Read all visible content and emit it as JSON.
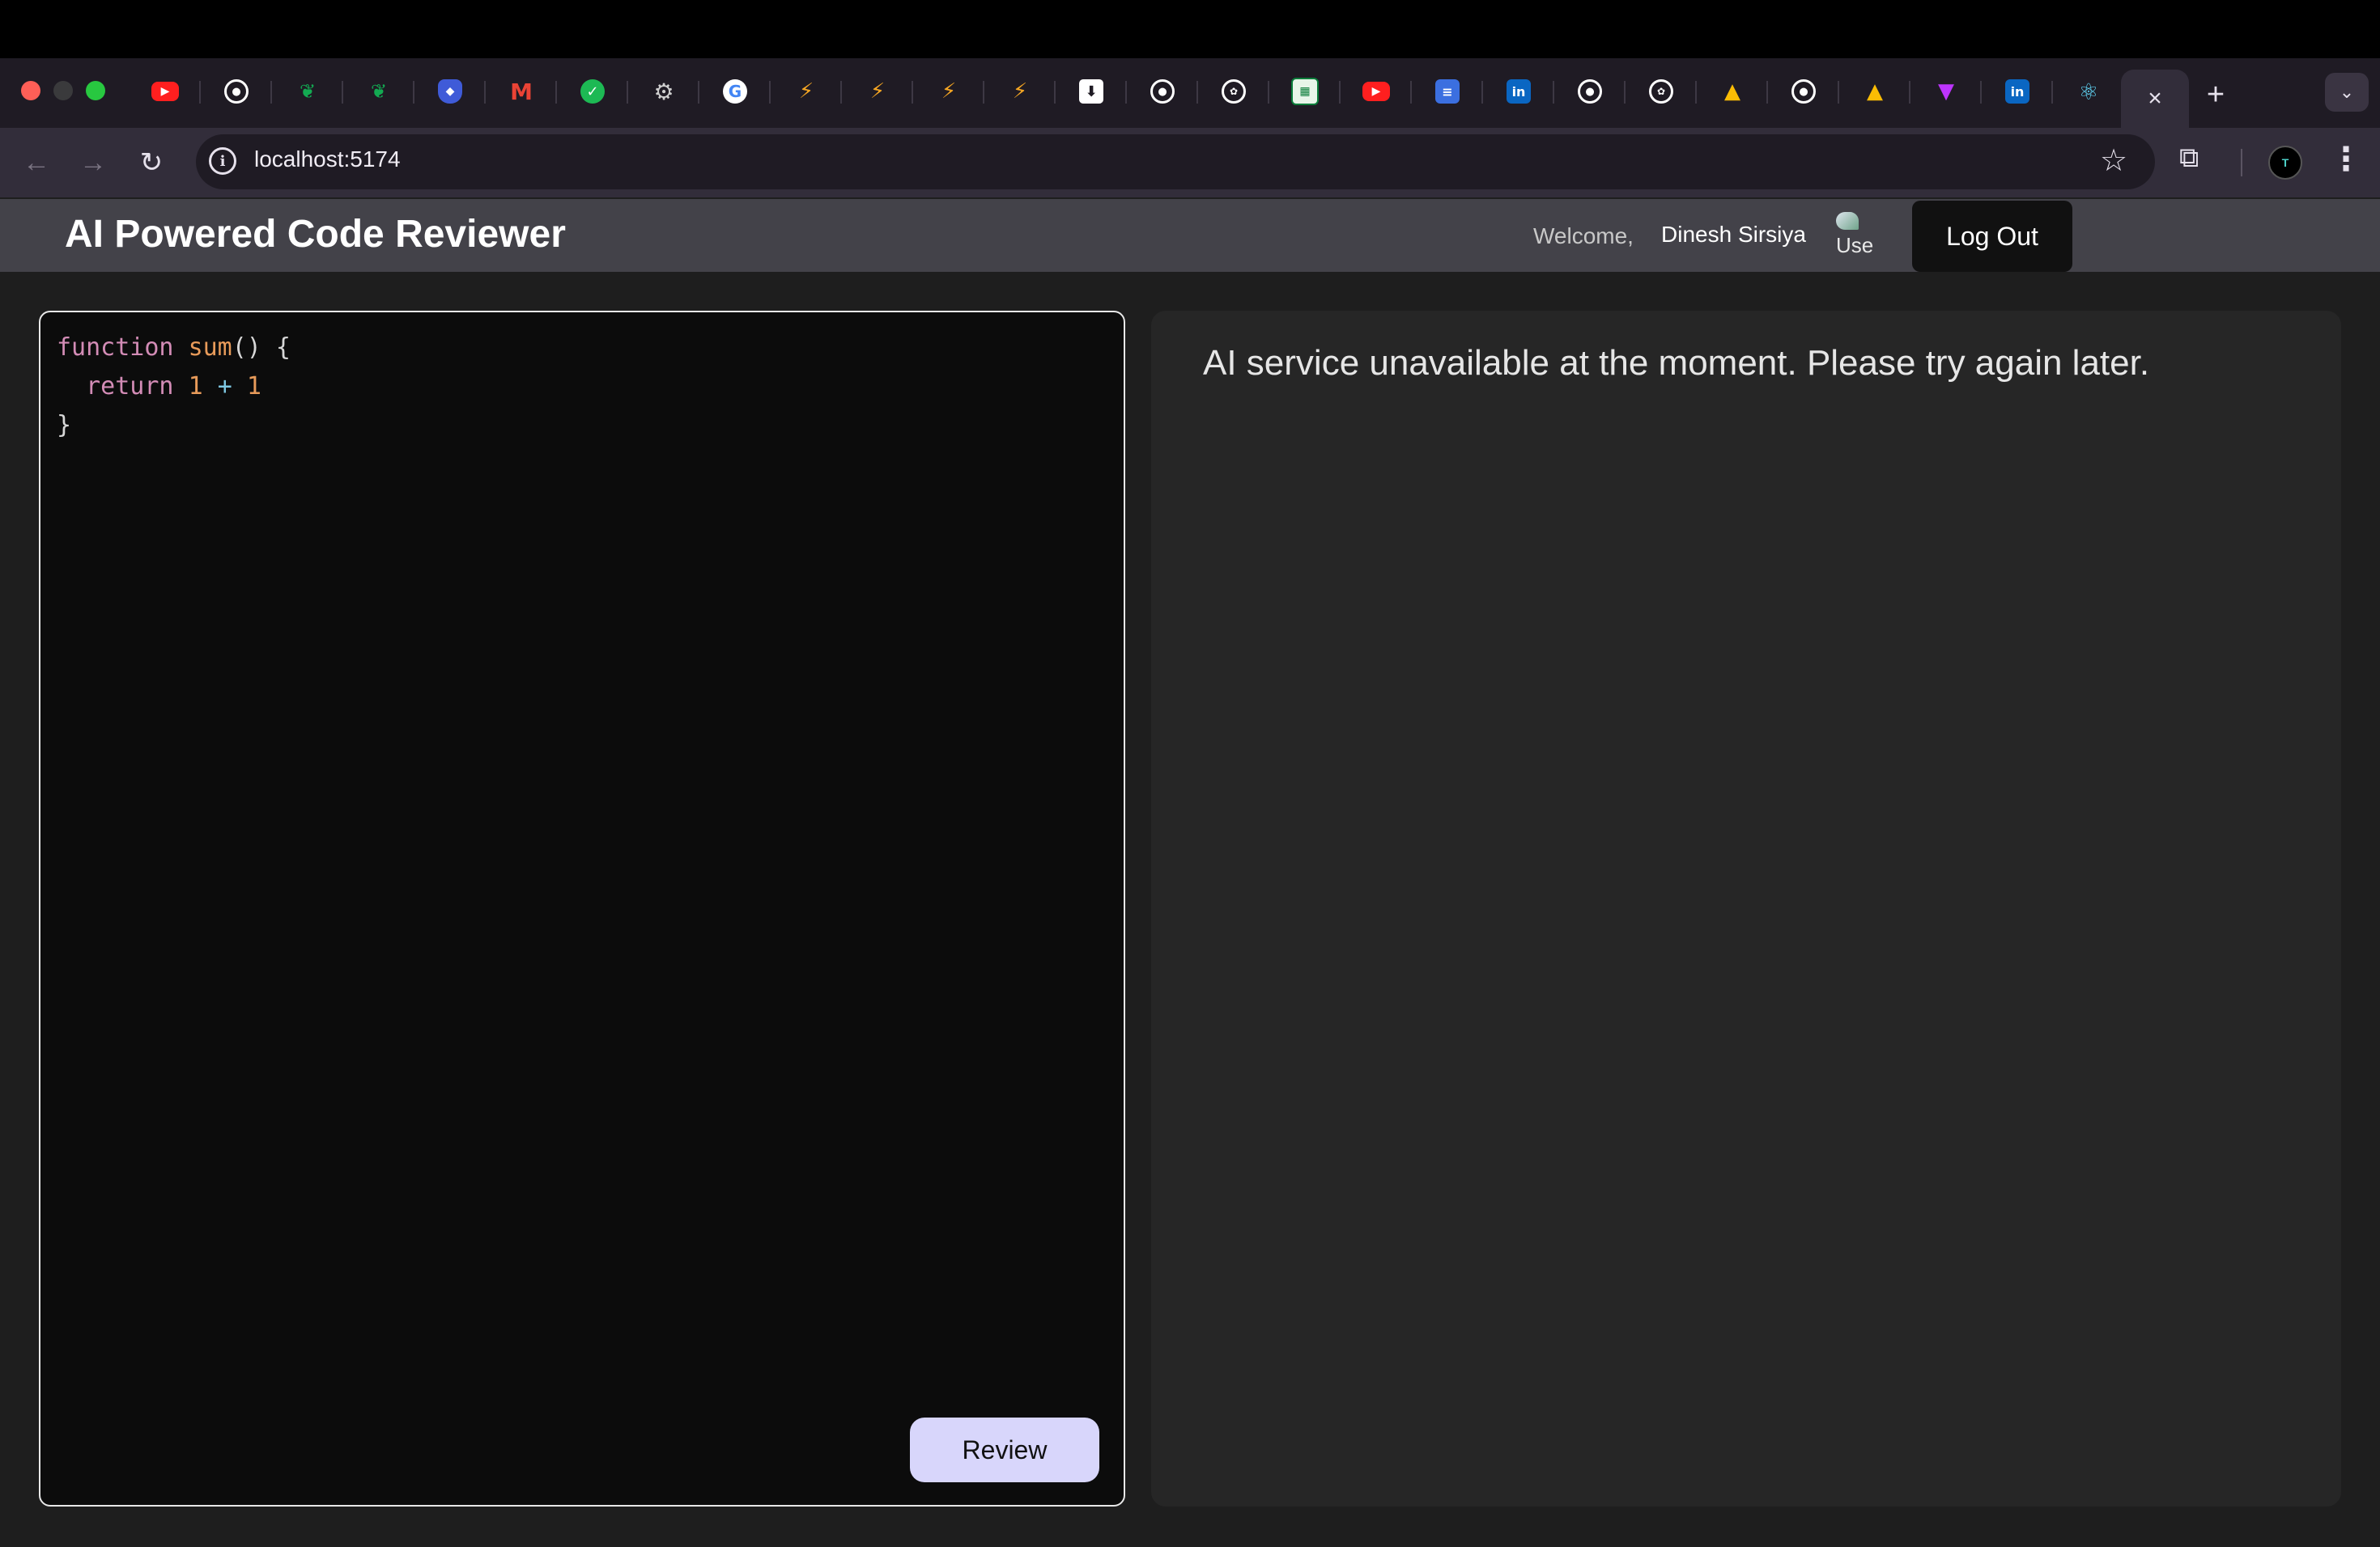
{
  "browser": {
    "url": "localhost:5174",
    "tabs": [
      {
        "icon": "youtube-icon",
        "glyph": "▶",
        "cls": "f-yt"
      },
      {
        "icon": "github-icon",
        "glyph": "●",
        "cls": "f-gh"
      },
      {
        "icon": "mongodb-leaf-icon",
        "glyph": "❦",
        "cls": "f-leaf"
      },
      {
        "icon": "mongodb-leaf-icon",
        "glyph": "❦",
        "cls": "f-leaf"
      },
      {
        "icon": "shield-icon",
        "glyph": "◆",
        "cls": "f-shield"
      },
      {
        "icon": "gmail-icon",
        "glyph": "M",
        "cls": "f-gmail"
      },
      {
        "icon": "check-icon",
        "glyph": "✓",
        "cls": "f-check"
      },
      {
        "icon": "gear-icon",
        "glyph": "⚙",
        "cls": "f-gear"
      },
      {
        "icon": "google-icon",
        "glyph": "G",
        "cls": "f-google"
      },
      {
        "icon": "arrow-icon",
        "glyph": "⚡",
        "cls": "f-arrow"
      },
      {
        "icon": "arrow-icon",
        "glyph": "⚡",
        "cls": "f-arrow"
      },
      {
        "icon": "arrow-icon",
        "glyph": "⚡",
        "cls": "f-arrow"
      },
      {
        "icon": "arrow-icon",
        "glyph": "⚡",
        "cls": "f-arrow"
      },
      {
        "icon": "download-icon",
        "glyph": "⬇",
        "cls": "f-down"
      },
      {
        "icon": "github-icon",
        "glyph": "●",
        "cls": "f-gh"
      },
      {
        "icon": "openai-icon",
        "glyph": "✿",
        "cls": "f-gpt"
      },
      {
        "icon": "certificate-icon",
        "glyph": "▦",
        "cls": "f-green"
      },
      {
        "icon": "youtube-icon",
        "glyph": "▶",
        "cls": "f-yt"
      },
      {
        "icon": "google-docs-icon",
        "glyph": "≡",
        "cls": "f-docs"
      },
      {
        "icon": "linkedin-icon",
        "glyph": "in",
        "cls": "f-in"
      },
      {
        "icon": "github-icon",
        "glyph": "●",
        "cls": "f-gh"
      },
      {
        "icon": "openai-icon",
        "glyph": "✿",
        "cls": "f-gpt"
      },
      {
        "icon": "google-drive-icon",
        "glyph": "▲",
        "cls": "f-drive"
      },
      {
        "icon": "github-icon",
        "glyph": "●",
        "cls": "f-gh"
      },
      {
        "icon": "google-drive-icon",
        "glyph": "▲",
        "cls": "f-drive"
      },
      {
        "icon": "vite-icon",
        "glyph": "▼",
        "cls": "f-vite"
      },
      {
        "icon": "linkedin-icon",
        "glyph": "in",
        "cls": "f-in"
      },
      {
        "icon": "react-icon",
        "glyph": "⚛",
        "cls": "f-react"
      }
    ],
    "active_tab_close": "×",
    "new_tab": "+",
    "tab_search": "⌄",
    "back": "←",
    "forward": "→",
    "reload": "↻",
    "site_info": "i",
    "bookmark": "☆",
    "extensions": "⧉",
    "profile": "T",
    "menu": "⋮"
  },
  "header": {
    "title": "AI Powered Code Reviewer",
    "welcome": "Welcome,",
    "user_name": "Dinesh Sirsiya",
    "avatar_alt": "Use",
    "logout_label": "Log Out"
  },
  "editor": {
    "review_label": "Review"
  },
  "result": {
    "message": "AI service unavailable at the moment. Please try again later."
  }
}
